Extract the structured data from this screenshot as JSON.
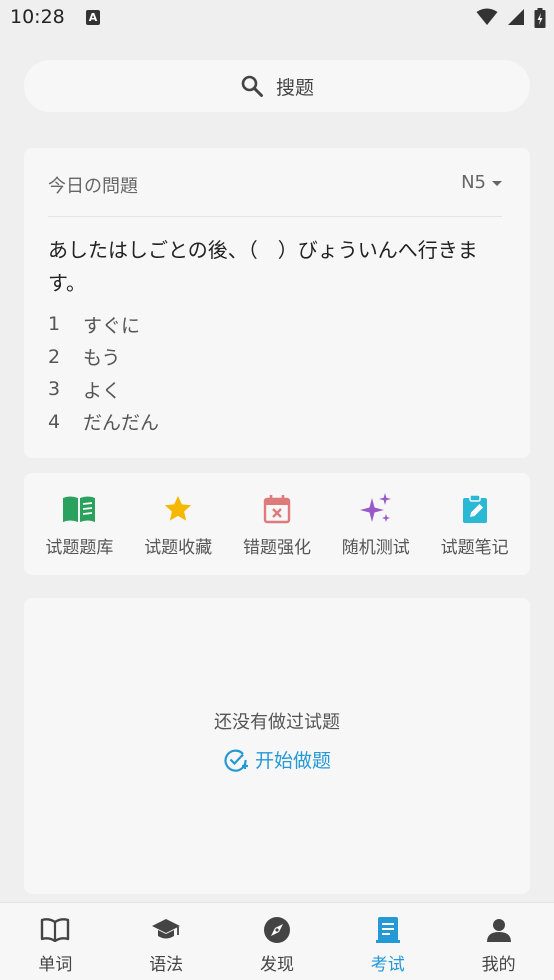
{
  "status_bar": {
    "time": "10:28",
    "notification_letter": "A"
  },
  "search": {
    "label": "搜题"
  },
  "daily": {
    "title": "今日の問題",
    "level": "N5",
    "question": "あしたはしごとの後、（　）びょういんへ行きます。",
    "options": [
      {
        "num": "1",
        "text": "すぐに"
      },
      {
        "num": "2",
        "text": "もう"
      },
      {
        "num": "3",
        "text": "よく"
      },
      {
        "num": "4",
        "text": "だんだん"
      }
    ]
  },
  "features": [
    {
      "label": "试题题库",
      "icon": "book-icon",
      "color": "#2aa15c"
    },
    {
      "label": "试题收藏",
      "icon": "star-icon",
      "color": "#f5b800"
    },
    {
      "label": "错题强化",
      "icon": "calendar-x-icon",
      "color": "#e07a7a"
    },
    {
      "label": "随机测试",
      "icon": "sparkle-icon",
      "color": "#9a59c9"
    },
    {
      "label": "试题笔记",
      "icon": "clipboard-edit-icon",
      "color": "#2bb8d4"
    }
  ],
  "history": {
    "empty_text": "还没有做过试题",
    "start_label": "开始做题"
  },
  "nav": {
    "items": [
      {
        "label": "单词",
        "icon": "book-open-icon"
      },
      {
        "label": "语法",
        "icon": "graduation-cap-icon"
      },
      {
        "label": "发现",
        "icon": "compass-icon"
      },
      {
        "label": "考试",
        "icon": "exam-icon"
      },
      {
        "label": "我的",
        "icon": "person-icon"
      }
    ],
    "active_index": 3,
    "active_color": "#2499d6"
  }
}
